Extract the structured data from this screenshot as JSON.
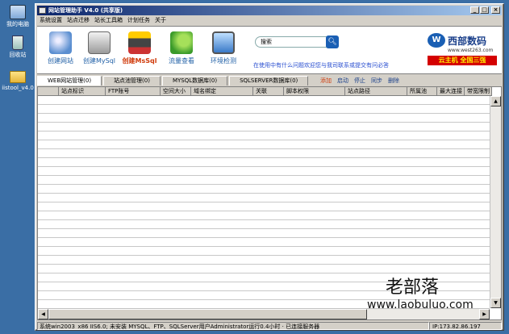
{
  "desktop": {
    "icons": [
      {
        "label": "我的电脑",
        "icon": "computer-icon"
      },
      {
        "label": "回收站",
        "icon": "recycle-bin-icon"
      },
      {
        "label": "iistool_v4.0",
        "icon": "folder-icon"
      }
    ]
  },
  "window": {
    "title": "网站管理助手 V4.0 (共享版)",
    "controls": [
      "_",
      "□",
      "×"
    ],
    "menu": [
      "系统设置",
      "站点迁移",
      "站长工具箱",
      "计划任务",
      "关于"
    ]
  },
  "toolbar": {
    "tools": [
      {
        "label": "创建网站",
        "icon": "tools-icon",
        "active": false
      },
      {
        "label": "创建MySql",
        "icon": "mysql-icon",
        "active": false
      },
      {
        "label": "创建MsSql",
        "icon": "mssql-icon",
        "active": true
      },
      {
        "label": "流量查看",
        "icon": "traffic-icon",
        "active": false
      },
      {
        "label": "环境检测",
        "icon": "monitor-icon",
        "active": false
      }
    ],
    "search_label": "搜索",
    "search_icon": "search-icon",
    "hint": "在使用中有什么问题欢迎您与我司联系或提交有问必答"
  },
  "brand": {
    "mark": "W",
    "name": "西部数码",
    "url": "www.west263.com",
    "slogan": "云主机 全国三强",
    "colors": {
      "primary": "#1a5fb4",
      "slogan_bg": "#d40000",
      "slogan_fg": "#fff000"
    }
  },
  "tabs": [
    {
      "label": "WEB网站管理(0)",
      "active": true
    },
    {
      "label": "站点池管理(0)",
      "active": false
    },
    {
      "label": "MYSQL数据库(0)",
      "active": false
    },
    {
      "label": "SQLSERVER数据库(0)",
      "active": false
    }
  ],
  "actions": [
    "添加",
    "启动",
    "停止",
    "同步",
    "删除"
  ],
  "table": {
    "columns": [
      "",
      "站点标识",
      "FTP账号",
      "空间大小",
      "域名绑定",
      "关联",
      "脚本权限",
      "站点路径",
      "所属池",
      "最大连接",
      "带宽限制"
    ],
    "rows": []
  },
  "statusbar": {
    "main": "系统win2003_x86 IIS6.0; 未安装 MYSQL、FTP、SQLServer用户Administrator运行0.4小时 · 已连接服务器",
    "ip": "IP:173.82.86.197"
  },
  "watermark": {
    "title": "老部落",
    "url": "www.laobuluo.com"
  }
}
